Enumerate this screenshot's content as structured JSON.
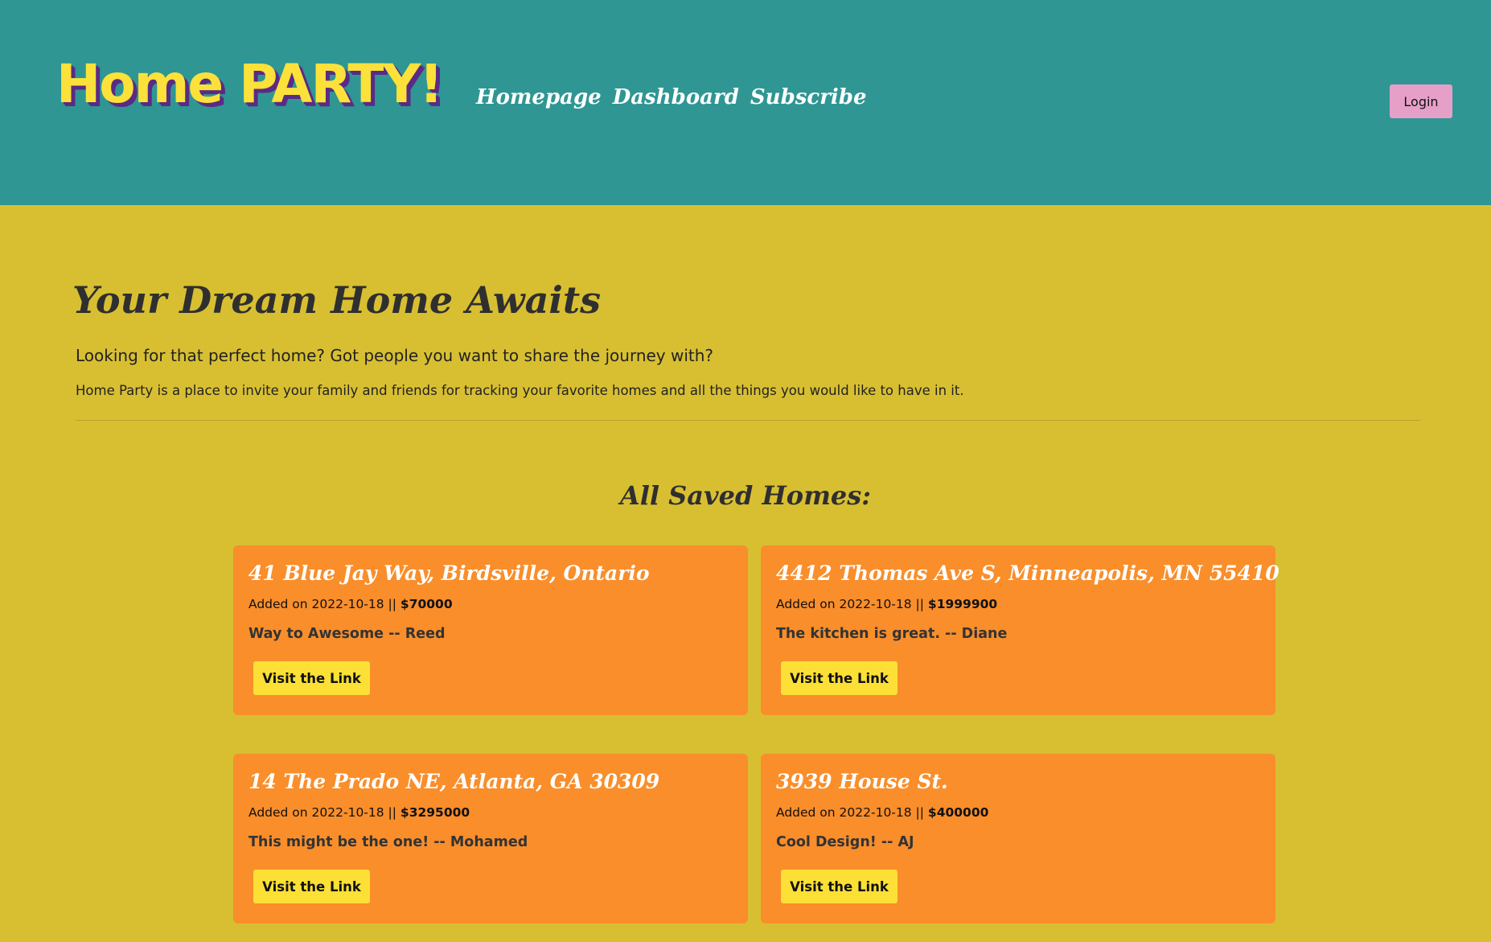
{
  "header": {
    "logo": "Home PARTY!",
    "nav": [
      "Homepage",
      "Dashboard",
      "Subscribe"
    ],
    "login_label": "Login"
  },
  "intro": {
    "title": "Your Dream Home Awaits",
    "lead": "Looking for that perfect home? Got people you want to share the journey with?",
    "description": "Home Party is a place to invite your family and friends for tracking your favorite homes and all the things you would like to have in it."
  },
  "saved": {
    "title": "All Saved Homes:",
    "homes": [
      {
        "address": "41 Blue Jay Way, Birdsville, Ontario",
        "added": "Added on 2022-10-18 || ",
        "price": "$70000",
        "comment": "Way to Awesome -- Reed",
        "button": "Visit the Link"
      },
      {
        "address": "4412 Thomas Ave S, Minneapolis, MN 55410",
        "added": "Added on 2022-10-18 || ",
        "price": "$1999900",
        "comment": "The kitchen is great. -- Diane",
        "button": "Visit the Link"
      },
      {
        "address": "14 The Prado NE, Atlanta, GA 30309",
        "added": "Added on 2022-10-18 || ",
        "price": "$3295000",
        "comment": "This might be the one! -- Mohamed",
        "button": "Visit the Link"
      },
      {
        "address": "3939 House St.",
        "added": "Added on 2022-10-18 || ",
        "price": "$400000",
        "comment": "Cool Design! -- AJ",
        "button": "Visit the Link"
      }
    ]
  },
  "colors": {
    "header_bg": "#2f9693",
    "page_bg": "#d8bf32",
    "card_bg": "#f98e2b",
    "button_bg": "#fde036",
    "login_bg": "#e6a0c8",
    "logo": "#fbe13a"
  }
}
